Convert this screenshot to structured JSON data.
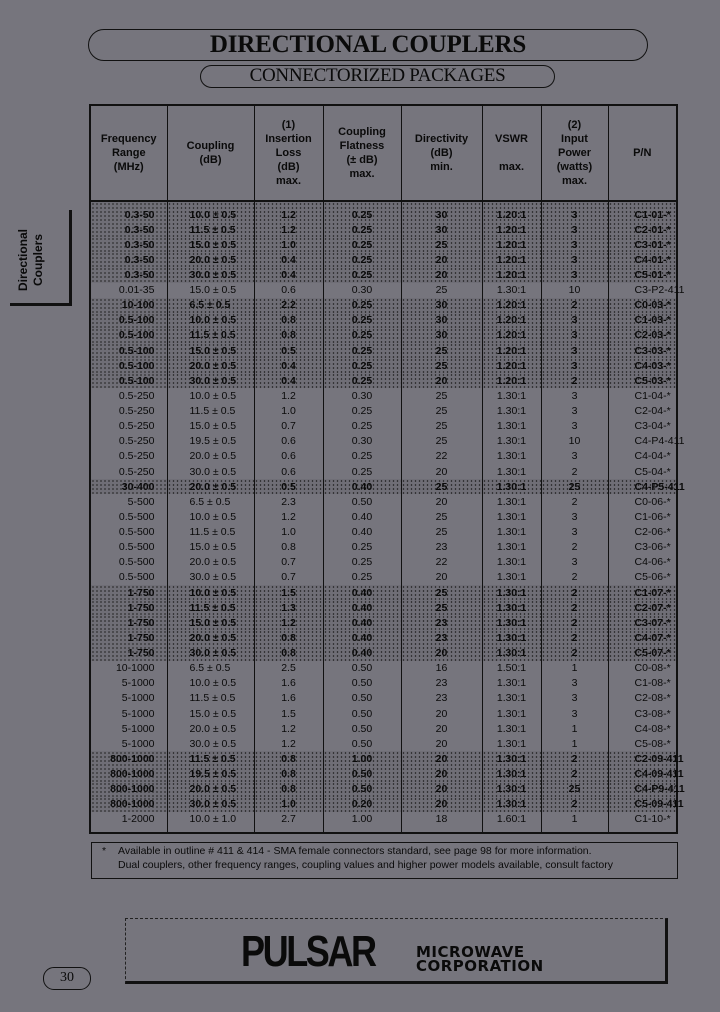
{
  "header": {
    "title": "DIRECTIONAL COUPLERS",
    "subtitle": "CONNECTORIZED PACKAGES"
  },
  "side_tab": {
    "line1": "Directional",
    "line2": "Couplers"
  },
  "table": {
    "columns": [
      {
        "lines": [
          "Frequency",
          "Range",
          "(MHz)"
        ]
      },
      {
        "lines": [
          "Coupling",
          "(dB)"
        ]
      },
      {
        "lines": [
          "(1)",
          "Insertion",
          "Loss",
          "(dB)",
          "max."
        ]
      },
      {
        "lines": [
          "Coupling",
          "Flatness",
          "(± dB)",
          "max."
        ]
      },
      {
        "lines": [
          "Directivity",
          "(dB)",
          "min."
        ]
      },
      {
        "lines": [
          "VSWR",
          "",
          "max."
        ]
      },
      {
        "lines": [
          "(2)",
          "Input",
          "Power",
          "(watts)",
          "max."
        ]
      },
      {
        "lines": [
          "P/N"
        ]
      }
    ],
    "rows": [
      {
        "shaded": true,
        "cells": [
          "0.3-50",
          "10.0 ± 0.5",
          "1.2",
          "0.25",
          "30",
          "1.20:1",
          "3",
          "C1-01-*"
        ]
      },
      {
        "shaded": true,
        "cells": [
          "0.3-50",
          "11.5 ± 0.5",
          "1.2",
          "0.25",
          "30",
          "1.20:1",
          "3",
          "C2-01-*"
        ]
      },
      {
        "shaded": true,
        "cells": [
          "0.3-50",
          "15.0 ± 0.5",
          "1.0",
          "0.25",
          "25",
          "1.20:1",
          "3",
          "C3-01-*"
        ]
      },
      {
        "shaded": true,
        "cells": [
          "0.3-50",
          "20.0 ± 0.5",
          "0.4",
          "0.25",
          "20",
          "1.20:1",
          "3",
          "C4-01-*"
        ]
      },
      {
        "shaded": true,
        "cells": [
          "0.3-50",
          "30.0 ± 0.5",
          "0.4",
          "0.25",
          "20",
          "1.20:1",
          "3",
          "C5-01-*"
        ]
      },
      {
        "shaded": false,
        "cells": [
          "0.01-35",
          "15.0 ± 0.5",
          "0.6",
          "0.30",
          "25",
          "1.30:1",
          "10",
          "C3-P2-411"
        ]
      },
      {
        "shaded": true,
        "cells": [
          "10-100",
          "6.5 ± 0.5",
          "2.2",
          "0.25",
          "30",
          "1.20:1",
          "2",
          "C0-03-*"
        ]
      },
      {
        "shaded": true,
        "cells": [
          "0.5-100",
          "10.0 ± 0.5",
          "0.8",
          "0.25",
          "30",
          "1.20:1",
          "3",
          "C1-03-*"
        ]
      },
      {
        "shaded": true,
        "cells": [
          "0.5-100",
          "11.5 ± 0.5",
          "0.8",
          "0.25",
          "30",
          "1.20:1",
          "3",
          "C2-03-*"
        ]
      },
      {
        "shaded": true,
        "cells": [
          "0.5-100",
          "15.0 ± 0.5",
          "0.5",
          "0.25",
          "25",
          "1.20:1",
          "3",
          "C3-03-*"
        ]
      },
      {
        "shaded": true,
        "cells": [
          "0.5-100",
          "20.0 ± 0.5",
          "0.4",
          "0.25",
          "25",
          "1.20:1",
          "3",
          "C4-03-*"
        ]
      },
      {
        "shaded": true,
        "cells": [
          "0.5-100",
          "30.0 ± 0.5",
          "0.4",
          "0.25",
          "20",
          "1.20:1",
          "2",
          "C5-03-*"
        ]
      },
      {
        "shaded": false,
        "cells": [
          "0.5-250",
          "10.0 ± 0.5",
          "1.2",
          "0.30",
          "25",
          "1.30:1",
          "3",
          "C1-04-*"
        ]
      },
      {
        "shaded": false,
        "cells": [
          "0.5-250",
          "11.5 ± 0.5",
          "1.0",
          "0.25",
          "25",
          "1.30:1",
          "3",
          "C2-04-*"
        ]
      },
      {
        "shaded": false,
        "cells": [
          "0.5-250",
          "15.0 ± 0.5",
          "0.7",
          "0.25",
          "25",
          "1.30:1",
          "3",
          "C3-04-*"
        ]
      },
      {
        "shaded": false,
        "cells": [
          "0.5-250",
          "19.5 ± 0.5",
          "0.6",
          "0.30",
          "25",
          "1.30:1",
          "10",
          "C4-P4-411"
        ]
      },
      {
        "shaded": false,
        "cells": [
          "0.5-250",
          "20.0 ± 0.5",
          "0.6",
          "0.25",
          "22",
          "1.30:1",
          "3",
          "C4-04-*"
        ]
      },
      {
        "shaded": false,
        "cells": [
          "0.5-250",
          "30.0 ± 0.5",
          "0.6",
          "0.25",
          "20",
          "1.30:1",
          "2",
          "C5-04-*"
        ]
      },
      {
        "shaded": true,
        "cells": [
          "30-400",
          "20.0 ± 0.5",
          "0.5",
          "0.40",
          "25",
          "1.30:1",
          "25",
          "C4-P5-411"
        ]
      },
      {
        "shaded": false,
        "cells": [
          "5-500",
          "6.5 ± 0.5",
          "2.3",
          "0.50",
          "20",
          "1.30:1",
          "2",
          "C0-06-*"
        ]
      },
      {
        "shaded": false,
        "cells": [
          "0.5-500",
          "10.0 ± 0.5",
          "1.2",
          "0.40",
          "25",
          "1.30:1",
          "3",
          "C1-06-*"
        ]
      },
      {
        "shaded": false,
        "cells": [
          "0.5-500",
          "11.5 ± 0.5",
          "1.0",
          "0.40",
          "25",
          "1.30:1",
          "3",
          "C2-06-*"
        ]
      },
      {
        "shaded": false,
        "cells": [
          "0.5-500",
          "15.0 ± 0.5",
          "0.8",
          "0.25",
          "23",
          "1.30:1",
          "2",
          "C3-06-*"
        ]
      },
      {
        "shaded": false,
        "cells": [
          "0.5-500",
          "20.0 ± 0.5",
          "0.7",
          "0.25",
          "22",
          "1.30:1",
          "3",
          "C4-06-*"
        ]
      },
      {
        "shaded": false,
        "cells": [
          "0.5-500",
          "30.0 ± 0.5",
          "0.7",
          "0.25",
          "20",
          "1.30:1",
          "2",
          "C5-06-*"
        ]
      },
      {
        "shaded": true,
        "cells": [
          "1-750",
          "10.0 ± 0.5",
          "1.5",
          "0.40",
          "25",
          "1.30:1",
          "2",
          "C1-07-*"
        ]
      },
      {
        "shaded": true,
        "cells": [
          "1-750",
          "11.5 ± 0.5",
          "1.3",
          "0.40",
          "25",
          "1.30:1",
          "2",
          "C2-07-*"
        ]
      },
      {
        "shaded": true,
        "cells": [
          "1-750",
          "15.0 ± 0.5",
          "1.2",
          "0.40",
          "23",
          "1.30:1",
          "2",
          "C3-07-*"
        ]
      },
      {
        "shaded": true,
        "cells": [
          "1-750",
          "20.0 ± 0.5",
          "0.8",
          "0.40",
          "23",
          "1.30:1",
          "2",
          "C4-07-*"
        ]
      },
      {
        "shaded": true,
        "cells": [
          "1-750",
          "30.0 ± 0.5",
          "0.8",
          "0.40",
          "20",
          "1.30:1",
          "2",
          "C5-07-*"
        ]
      },
      {
        "shaded": false,
        "cells": [
          "10-1000",
          "6.5 ± 0.5",
          "2.5",
          "0.50",
          "16",
          "1.50:1",
          "1",
          "C0-08-*"
        ]
      },
      {
        "shaded": false,
        "cells": [
          "5-1000",
          "10.0 ± 0.5",
          "1.6",
          "0.50",
          "23",
          "1.30:1",
          "3",
          "C1-08-*"
        ]
      },
      {
        "shaded": false,
        "cells": [
          "5-1000",
          "11.5 ± 0.5",
          "1.6",
          "0.50",
          "23",
          "1.30:1",
          "3",
          "C2-08-*"
        ]
      },
      {
        "shaded": false,
        "cells": [
          "5-1000",
          "15.0 ± 0.5",
          "1.5",
          "0.50",
          "20",
          "1.30:1",
          "3",
          "C3-08-*"
        ]
      },
      {
        "shaded": false,
        "cells": [
          "5-1000",
          "20.0 ± 0.5",
          "1.2",
          "0.50",
          "20",
          "1.30:1",
          "1",
          "C4-08-*"
        ]
      },
      {
        "shaded": false,
        "cells": [
          "5-1000",
          "30.0 ± 0.5",
          "1.2",
          "0.50",
          "20",
          "1.30:1",
          "1",
          "C5-08-*"
        ]
      },
      {
        "shaded": true,
        "cells": [
          "800-1000",
          "11.5 ± 0.5",
          "0.8",
          "1.00",
          "20",
          "1.30:1",
          "2",
          "C2-09-411"
        ]
      },
      {
        "shaded": true,
        "cells": [
          "800-1000",
          "19.5 ± 0.5",
          "0.8",
          "0.50",
          "20",
          "1.30:1",
          "2",
          "C4-09-411"
        ]
      },
      {
        "shaded": true,
        "cells": [
          "800-1000",
          "20.0 ± 0.5",
          "0.8",
          "0.50",
          "20",
          "1.30:1",
          "25",
          "C4-P9-411"
        ]
      },
      {
        "shaded": true,
        "cells": [
          "800-1000",
          "30.0 ± 0.5",
          "1.0",
          "0.20",
          "20",
          "1.30:1",
          "2",
          "C5-09-411"
        ]
      },
      {
        "shaded": false,
        "cells": [
          "1-2000",
          "10.0 ± 1.0",
          "2.7",
          "1.00",
          "18",
          "1.60:1",
          "1",
          "C1-10-*"
        ]
      }
    ]
  },
  "footnote": {
    "mark": "*",
    "line1": "Available in outline # 411 & 414 - SMA female connectors standard,  see page 98 for more information.",
    "line2": "Dual couplers, other frequency ranges, coupling values and higher power models available, consult factory"
  },
  "logo": {
    "brand": "PULSAR",
    "line1": "MICROWAVE",
    "line2": "CORPORATION"
  },
  "page_number": "30"
}
